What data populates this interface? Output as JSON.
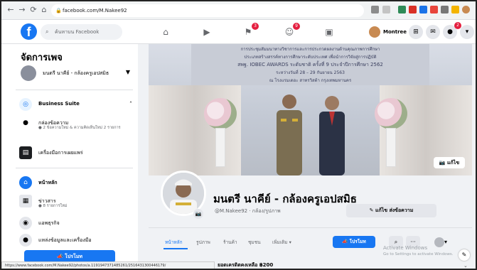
{
  "browser": {
    "url": "facebook.com/M.Nakee92"
  },
  "fb_header": {
    "search_placeholder": "ค้นหาบน Facebook",
    "badges": {
      "pages": "3",
      "groups": "9",
      "notifications": "2"
    },
    "profile_name": "Montree"
  },
  "sidebar": {
    "title": "จัดการเพจ",
    "account_name": "มนตรี นาคีย์ - กล้องครูเอปสมิธ",
    "business_suite": "Business Suite",
    "inbox": {
      "label": "กล่องข้อความ",
      "sub": "● 2 ข้อความใหม่ & ความคิดเห็นใหม่ 2 รายการ"
    },
    "tools": "เครื่องมือการเผยแพร่",
    "home": "หน้าหลัก",
    "news": {
      "label": "ข่าวสาร",
      "sub": "● 8 รายการใหม่"
    },
    "business": "แอพธุรกิจ",
    "more": "แหล่งข้อมูลและเครื่องมือ",
    "promote": "โปรโมท"
  },
  "cover": {
    "banner_lines": [
      "การประชุมสัมมนาทางวิชาการและการประกวดผลงานด้านคุณภาพการศึกษา",
      "ประเภทสร้างสรรค์ทางการศึกษาระดับประเทศ เพื่อนำการวิจัยสู่การปฏิบัติ",
      "สพฐ. IOBEC AWARDS ระดับชาติ ครั้งที่ 9 ประจำปีการศึกษา 2562",
      "ระหว่างวันที่ 28 – 29 กันยายน 2563",
      "ณ โรงแรมเดอะ สาทรวิสต้า กรุงเทพมหานคร"
    ],
    "edit_label": "แก้ไข"
  },
  "profile": {
    "page_name": "มนตรี นาคีย์ - กล้องครูเอปสมิธ",
    "handle": "@M.Nakee92 · กล้อง/รูปภาพ",
    "edit_send": "แก้ไข ส่งข้อความ",
    "tabs": [
      "หน้าหลัก",
      "รูปภาพ",
      "ร้านค้า",
      "ชุมชน",
      "เพิ่มเติม ▾"
    ],
    "promote": "โปรโมท"
  },
  "status_url": "https://www.facebook.com/M.Nakee92/photos/a.1191947371485261/2516431300446179/",
  "bottom_text": "ยอดเครดิตคงเหลือ ฿200",
  "watermark": {
    "title": "Activate Windows",
    "sub": "Go to Settings to activate Windows."
  }
}
